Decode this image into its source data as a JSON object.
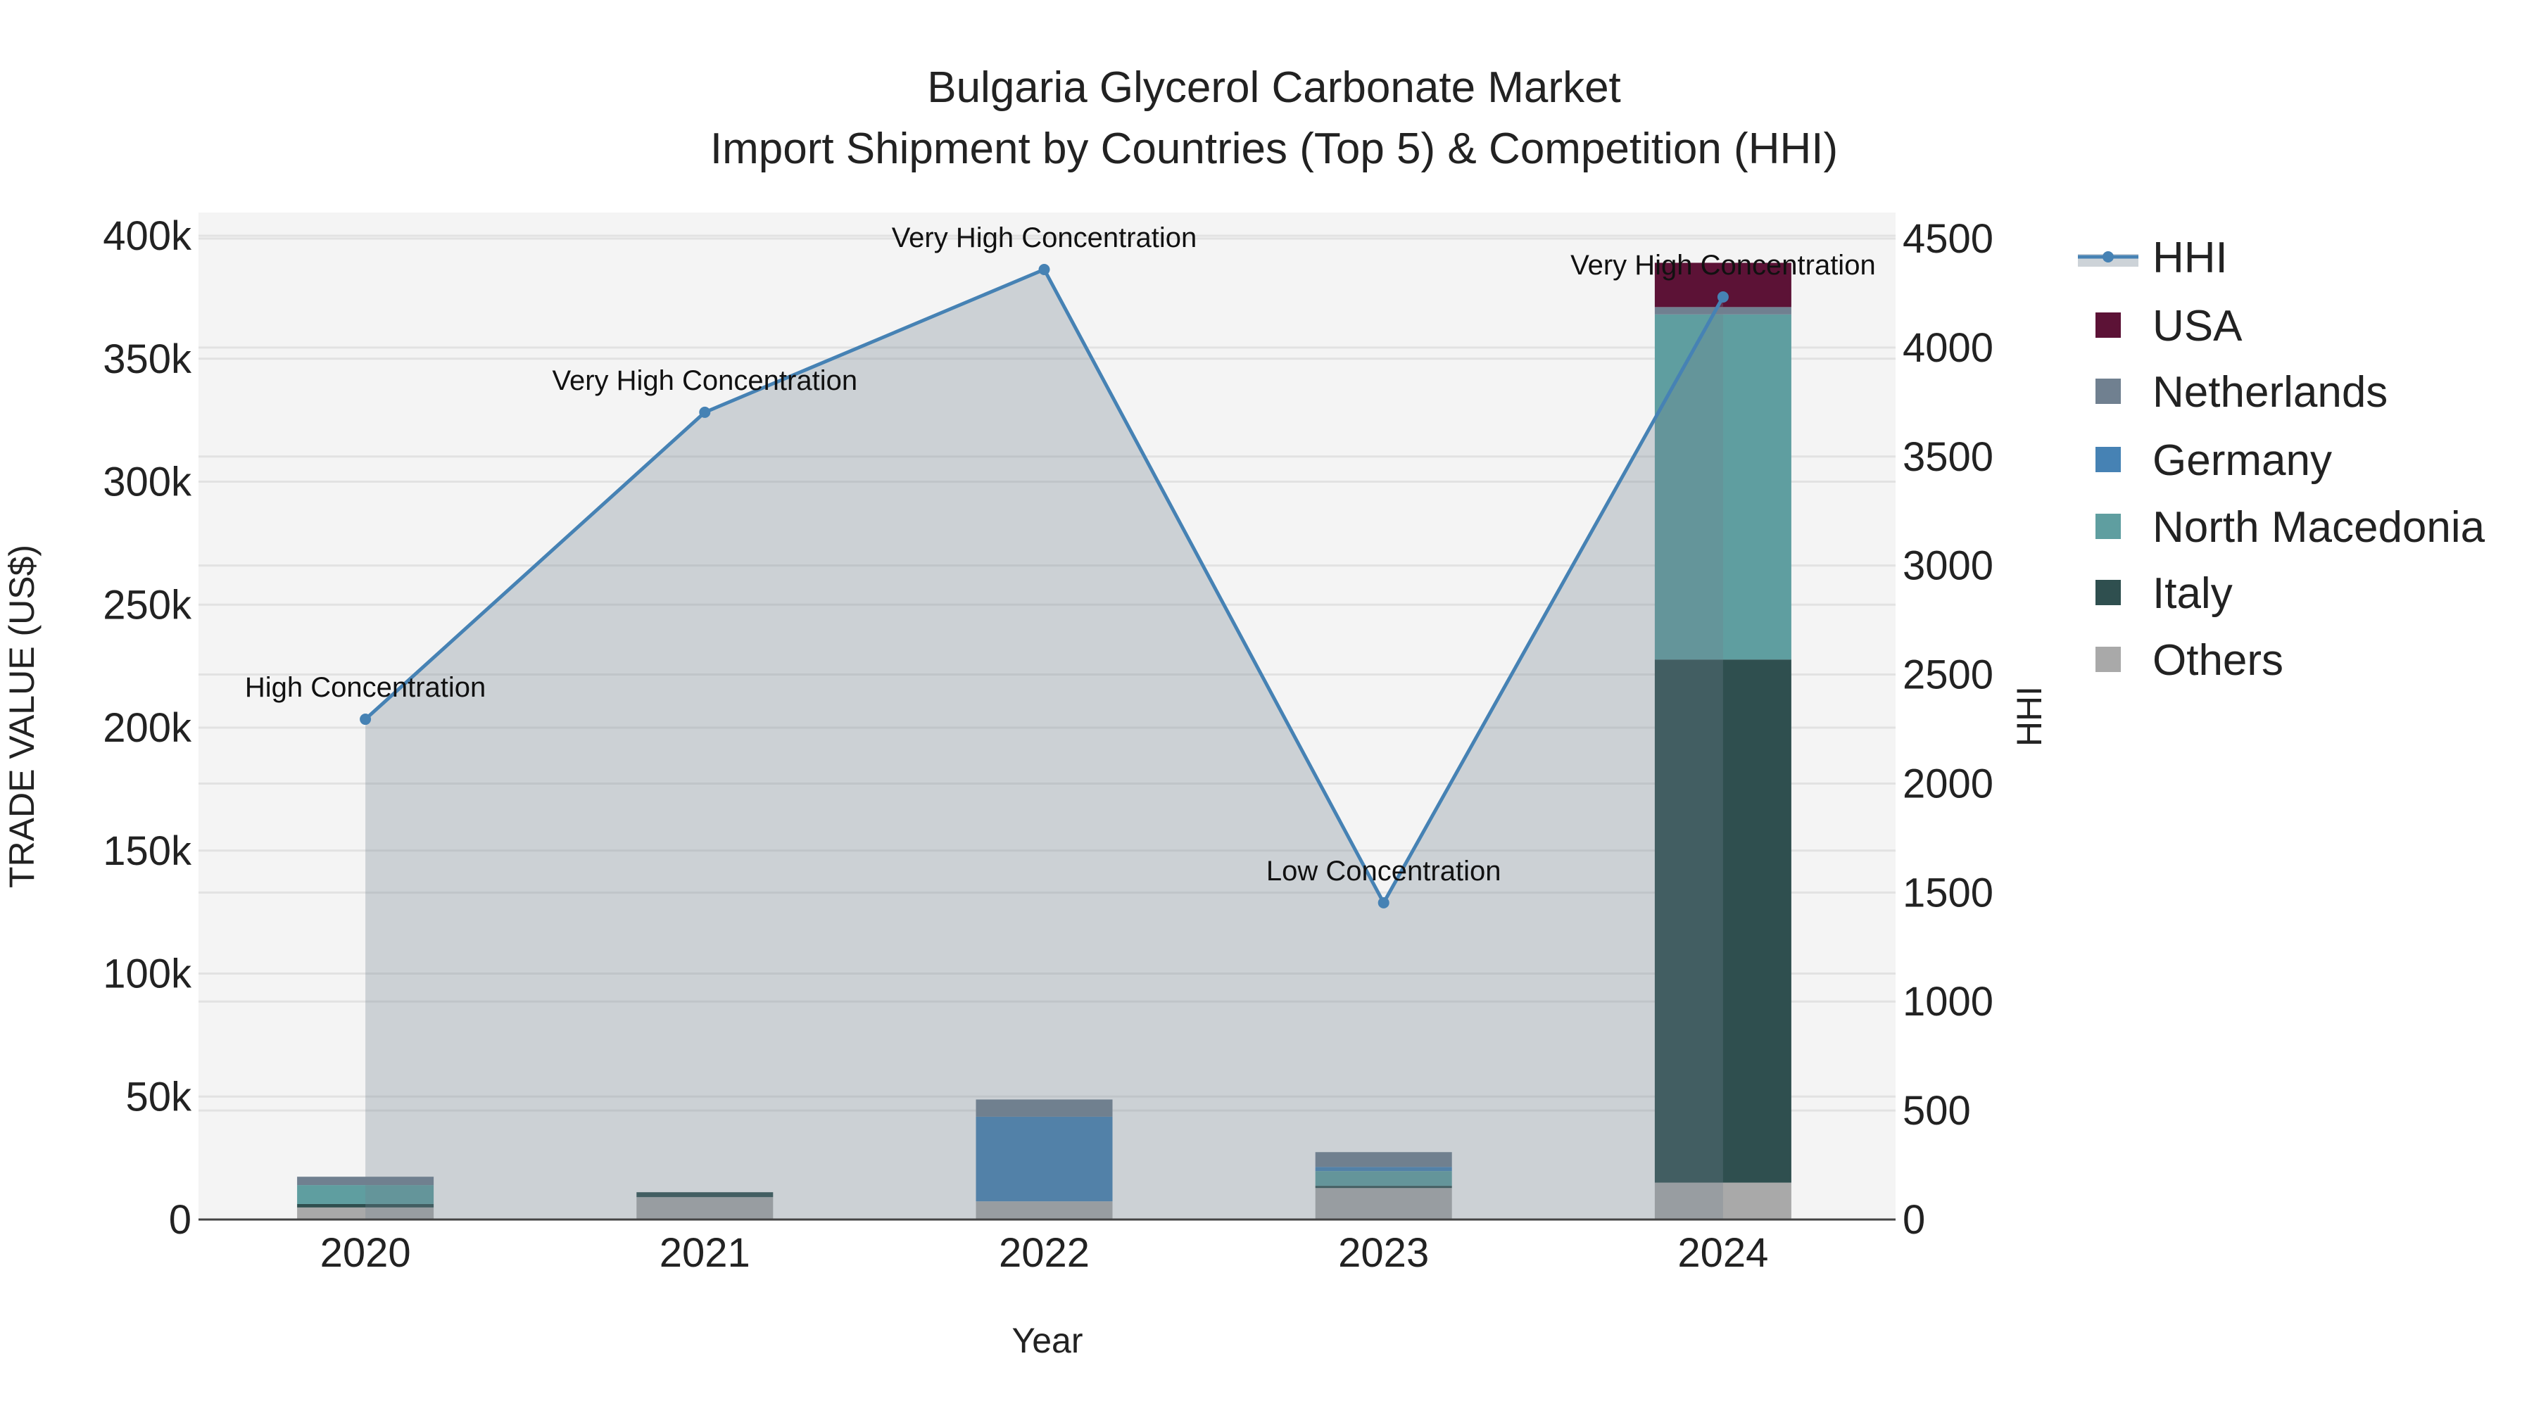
{
  "chart_data": {
    "type": "bar",
    "title": "Bulgaria Glycerol Carbonate Market",
    "subtitle": "Import Shipment by Countries (Top 5) & Competition (HHI)",
    "xlabel": "Year",
    "ylabel": "TRADE VALUE (US$)",
    "y2label": "HHI",
    "categories": [
      "2020",
      "2021",
      "2022",
      "2023",
      "2024"
    ],
    "ylim": [
      0,
      400000
    ],
    "y2lim": [
      0,
      4500
    ],
    "yticks": [
      0,
      50000,
      100000,
      150000,
      200000,
      250000,
      300000,
      350000,
      400000
    ],
    "ytick_labels": [
      "0",
      "50k",
      "100k",
      "150k",
      "200k",
      "250k",
      "300k",
      "350k",
      "400k"
    ],
    "y2ticks": [
      0,
      500,
      1000,
      1500,
      2000,
      2500,
      3000,
      3500,
      4000,
      4500
    ],
    "y2tick_labels": [
      "0",
      "500",
      "1000",
      "1500",
      "2000",
      "2500",
      "3000",
      "3500",
      "4000",
      "4500"
    ],
    "grid": true,
    "legend_position": "right",
    "series": [
      {
        "name": "Others",
        "color": "#a9a9a9",
        "values": [
          4900,
          9100,
          7400,
          12800,
          15000
        ]
      },
      {
        "name": "Italy",
        "color": "#2f4f4f",
        "values": [
          1400,
          2000,
          0,
          900,
          212700
        ]
      },
      {
        "name": "North Macedonia",
        "color": "#5f9ea0",
        "values": [
          7700,
          0,
          0,
          6000,
          140300
        ]
      },
      {
        "name": "Germany",
        "color": "#4682b4",
        "values": [
          0,
          0,
          34400,
          1700,
          0
        ]
      },
      {
        "name": "Netherlands",
        "color": "#708090",
        "values": [
          3400,
          0,
          7000,
          6000,
          3000
        ]
      },
      {
        "name": "USA",
        "color": "#5c1236",
        "values": [
          0,
          0,
          0,
          0,
          18000
        ]
      }
    ],
    "hhi": {
      "name": "HHI",
      "color": "#4682b4",
      "values": [
        2295,
        3703,
        4358,
        1453,
        4232
      ],
      "labels": [
        "High Concentration",
        "Very High Concentration",
        "Very High Concentration",
        "Low Concentration",
        "Very High Concentration"
      ]
    },
    "legend_order": [
      "HHI",
      "USA",
      "Netherlands",
      "Germany",
      "North Macedonia",
      "Italy",
      "Others"
    ]
  }
}
